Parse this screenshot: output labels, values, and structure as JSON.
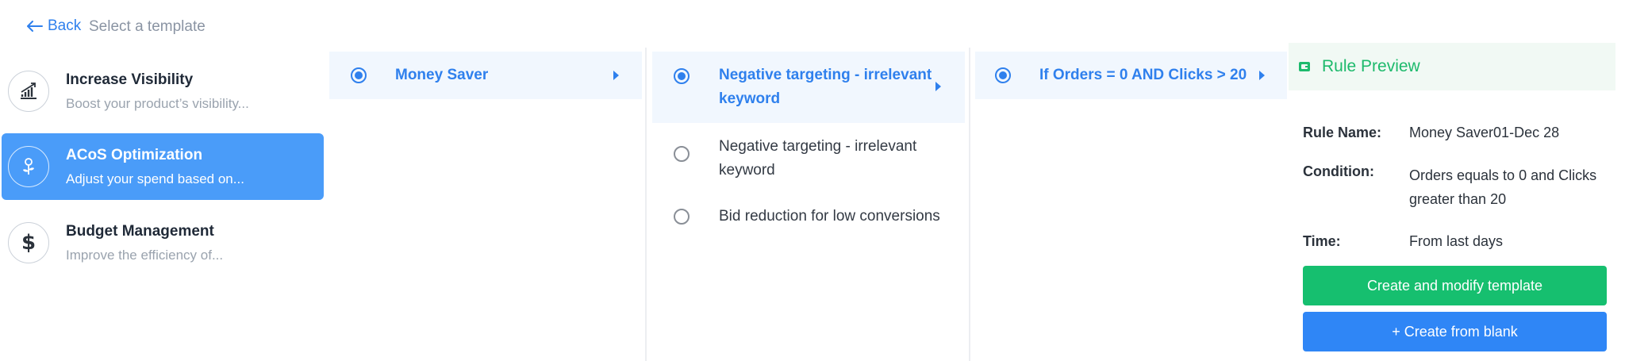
{
  "header": {
    "back_label": "Back",
    "subtitle": "Select a template"
  },
  "categories": [
    {
      "title": "Increase Visibility",
      "desc": "Boost your product’s visibility...",
      "icon": "chart-up-icon",
      "active": false
    },
    {
      "title": "ACoS Optimization",
      "desc": "Adjust your spend based on...",
      "icon": "sprout-icon",
      "active": true
    },
    {
      "title": "Budget Management",
      "desc": "Improve the efficiency of...",
      "icon": "dollar-icon",
      "active": false
    }
  ],
  "column2": {
    "options": [
      {
        "label": "Money Saver",
        "selected": true
      }
    ]
  },
  "column3": {
    "options": [
      {
        "label_line1": "Negative targeting - irrelevant",
        "label_line2": "keyword",
        "selected": true
      },
      {
        "label_line1": "Negative targeting - irrelevant",
        "label_line2": "keyword",
        "selected": false
      },
      {
        "label_line1": "Bid reduction for low conversions",
        "label_line2": "",
        "selected": false
      }
    ]
  },
  "column4": {
    "options": [
      {
        "label": "If Orders = 0 AND Clicks > 20",
        "selected": true
      }
    ]
  },
  "preview": {
    "title": "Rule Preview",
    "icon": "wallet-icon",
    "rule_name_label": "Rule Name:",
    "rule_name_value": "Money Saver01-Dec 28",
    "condition_label": "Condition:",
    "condition_line1": "Orders equals to 0 and Clicks",
    "condition_line2": "greater than 20",
    "time_label": "Time:",
    "time_value": "From last days",
    "create_modify_label": "Create and modify template",
    "create_blank_label": "+ Create from blank"
  },
  "colors": {
    "accent_blue": "#2f80ed",
    "active_category": "#4a9cf9",
    "selected_row_bg": "#f1f7fe",
    "preview_green": "#1dba6c",
    "button_green": "#16bf6f",
    "button_blue": "#2f86f6"
  }
}
